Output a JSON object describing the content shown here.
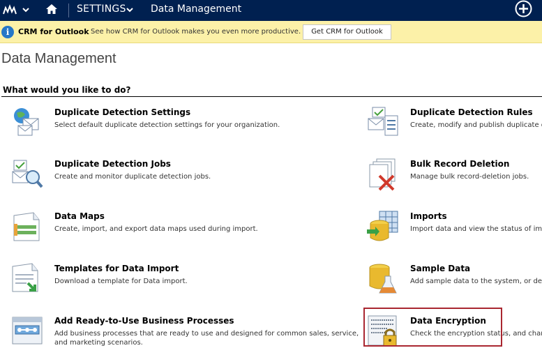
{
  "topbar": {
    "settings_label": "SETTINGS",
    "breadcrumb": "Data Management"
  },
  "notification": {
    "title": "CRM for Outlook",
    "message": "See how CRM for Outlook makes you even more productive.",
    "button_label": "Get CRM for Outlook"
  },
  "page": {
    "title": "Data Management",
    "section_heading": "What would you like to do?"
  },
  "items": [
    {
      "title": "Duplicate Detection Settings",
      "description": "Select default duplicate detection settings for your organization."
    },
    {
      "title": "Duplicate Detection Rules",
      "description": "Create, modify and publish duplicate de"
    },
    {
      "title": "Duplicate Detection Jobs",
      "description": "Create and monitor duplicate detection jobs."
    },
    {
      "title": "Bulk Record Deletion",
      "description": "Manage bulk record-deletion jobs."
    },
    {
      "title": "Data Maps",
      "description": "Create, import, and export data maps used during import."
    },
    {
      "title": "Imports",
      "description": "Import data and view the status of imp"
    },
    {
      "title": "Templates for Data Import",
      "description": "Download a template for Data import."
    },
    {
      "title": "Sample Data",
      "description": "Add sample data to the system, or dele"
    },
    {
      "title": "Add Ready-to-Use Business Processes",
      "description": "Add business processes that are ready to use and designed for common sales, service, and marketing scenarios."
    },
    {
      "title": "Data Encryption",
      "description": "Check the encryption status, and chang"
    }
  ],
  "colors": {
    "nav_bg": "#002050",
    "notify_bg": "#fcf1a8",
    "highlight": "#a92630"
  }
}
